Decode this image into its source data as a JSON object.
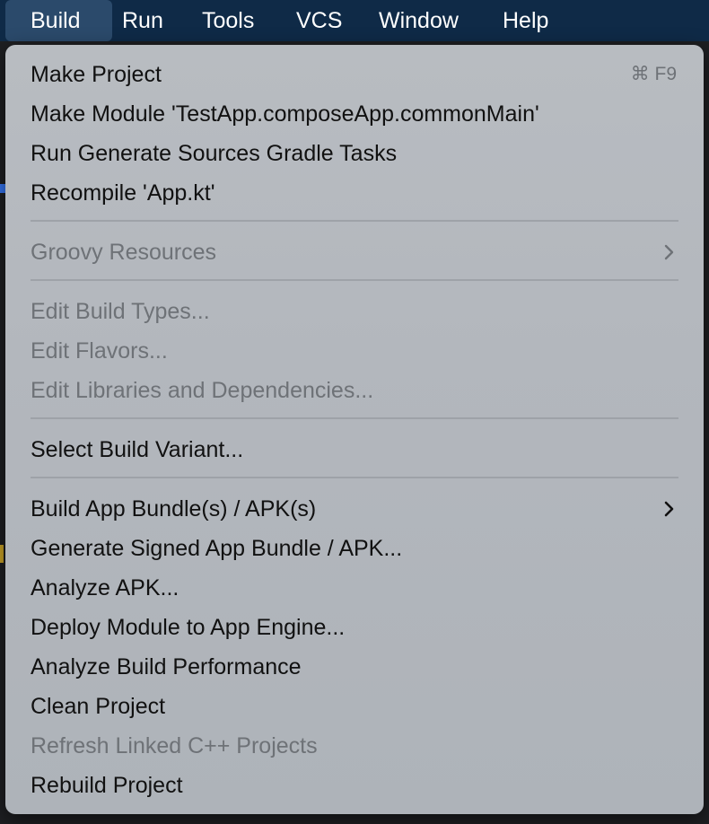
{
  "menubar": {
    "items": [
      "Build",
      "Run",
      "Tools",
      "VCS",
      "Window",
      "Help"
    ],
    "active": "Build"
  },
  "menu": {
    "make_project": {
      "label": "Make Project",
      "shortcut": "⌘ F9"
    },
    "make_module": {
      "label": "Make Module 'TestApp.composeApp.commonMain'"
    },
    "run_generate": {
      "label": "Run Generate Sources Gradle Tasks"
    },
    "recompile": {
      "label": "Recompile 'App.kt'"
    },
    "groovy_resources": {
      "label": "Groovy Resources",
      "enabled": false,
      "submenu": true
    },
    "edit_build_types": {
      "label": "Edit Build Types...",
      "enabled": false
    },
    "edit_flavors": {
      "label": "Edit Flavors...",
      "enabled": false
    },
    "edit_libraries": {
      "label": "Edit Libraries and Dependencies...",
      "enabled": false
    },
    "select_build_variant": {
      "label": "Select Build Variant..."
    },
    "build_app_bundle": {
      "label": "Build App Bundle(s) / APK(s)",
      "submenu": true
    },
    "generate_signed": {
      "label": "Generate Signed App Bundle / APK..."
    },
    "analyze_apk": {
      "label": "Analyze APK..."
    },
    "deploy_module": {
      "label": "Deploy Module to App Engine..."
    },
    "analyze_build": {
      "label": "Analyze Build Performance"
    },
    "clean_project": {
      "label": "Clean Project"
    },
    "refresh_linked": {
      "label": "Refresh Linked C++ Projects",
      "enabled": false
    },
    "rebuild_project": {
      "label": "Rebuild Project"
    }
  },
  "colors": {
    "menubar_bg": "#0f2a47",
    "menubar_active": "#2b4a6b",
    "menu_bg": "#b5b9be",
    "text": "#111111",
    "disabled_text": "#6e7277"
  },
  "icons": {
    "submenu": "chevron-right-icon",
    "shortcut_modifier": "command-key"
  }
}
